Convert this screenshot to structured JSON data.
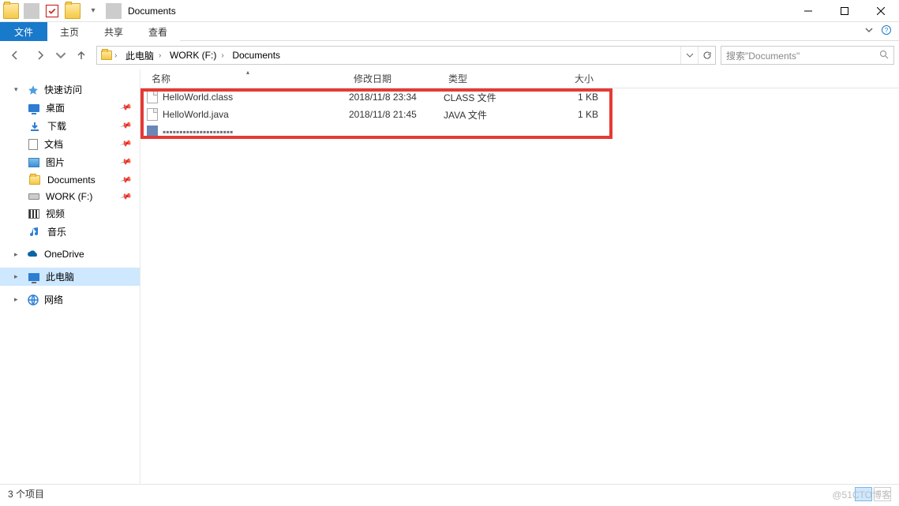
{
  "window": {
    "title": "Documents"
  },
  "ribbon": {
    "file": "文件",
    "tabs": [
      "主页",
      "共享",
      "查看"
    ]
  },
  "breadcrumb": [
    "此电脑",
    "WORK (F:)",
    "Documents"
  ],
  "search": {
    "placeholder": "搜索\"Documents\""
  },
  "nav": {
    "quick": {
      "label": "快速访问",
      "items": [
        {
          "label": "桌面",
          "icon": "desktop",
          "pinned": true
        },
        {
          "label": "下载",
          "icon": "download",
          "pinned": true
        },
        {
          "label": "文档",
          "icon": "doc",
          "pinned": true
        },
        {
          "label": "图片",
          "icon": "pic",
          "pinned": true
        },
        {
          "label": "Documents",
          "icon": "folder",
          "pinned": true
        },
        {
          "label": "WORK (F:)",
          "icon": "drive",
          "pinned": true
        },
        {
          "label": "视频",
          "icon": "video",
          "pinned": false
        },
        {
          "label": "音乐",
          "icon": "music",
          "pinned": false
        }
      ]
    },
    "onedrive": {
      "label": "OneDrive"
    },
    "thispc": {
      "label": "此电脑"
    },
    "network": {
      "label": "网络"
    }
  },
  "columns": {
    "name": "名称",
    "date": "修改日期",
    "type": "类型",
    "size": "大小"
  },
  "files": [
    {
      "name": "HelloWorld.class",
      "date": "2018/11/8 23:34",
      "type": "CLASS 文件",
      "size": "1 KB",
      "icon": "file"
    },
    {
      "name": "HelloWorld.java",
      "date": "2018/11/8 21:45",
      "type": "JAVA 文件",
      "size": "1 KB",
      "icon": "file"
    }
  ],
  "status": {
    "text": "3 个项目"
  },
  "watermark": "@51CTO博客"
}
